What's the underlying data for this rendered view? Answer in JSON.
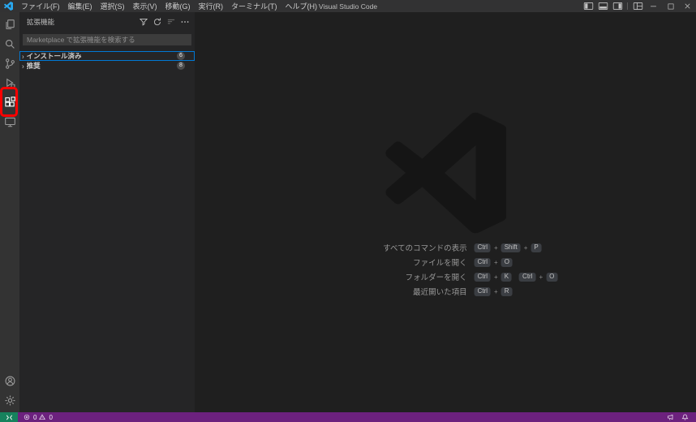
{
  "title_bar": {
    "app_title": "Visual Studio Code",
    "menus": [
      {
        "id": "file",
        "label": "ファイル(F)"
      },
      {
        "id": "edit",
        "label": "編集(E)"
      },
      {
        "id": "selection",
        "label": "選択(S)"
      },
      {
        "id": "view",
        "label": "表示(V)"
      },
      {
        "id": "go",
        "label": "移動(G)"
      },
      {
        "id": "run",
        "label": "実行(R)"
      },
      {
        "id": "terminal",
        "label": "ターミナル(T)"
      },
      {
        "id": "help",
        "label": "ヘルプ(H)"
      }
    ]
  },
  "sidebar": {
    "title": "拡張機能",
    "search_placeholder": "Marketplace で拡張機能を検索する",
    "sections": [
      {
        "id": "installed",
        "label": "インストール済み",
        "badge": "6",
        "focused": true
      },
      {
        "id": "recommended",
        "label": "推奨",
        "badge": "8",
        "focused": false
      }
    ]
  },
  "editor": {
    "key_separator": "+",
    "shortcuts": [
      {
        "label": "すべてのコマンドの表示",
        "groups": [
          [
            "Ctrl",
            "Shift",
            "P"
          ]
        ]
      },
      {
        "label": "ファイルを開く",
        "groups": [
          [
            "Ctrl",
            "O"
          ]
        ]
      },
      {
        "label": "フォルダーを開く",
        "groups": [
          [
            "Ctrl",
            "K"
          ],
          [
            "Ctrl",
            "O"
          ]
        ]
      },
      {
        "label": "最近開いた項目",
        "groups": [
          [
            "Ctrl",
            "R"
          ]
        ]
      }
    ]
  },
  "status_bar": {
    "errors": "0",
    "warnings": "0"
  },
  "annotation": {
    "target": "extensions-icon",
    "color": "#ff0000"
  },
  "colors": {
    "titlebar": "#323233",
    "activitybar": "#333333",
    "sidebar": "#252526",
    "editor": "#1f1f1f",
    "statusbar": "#6c217e",
    "remote": "#16825d",
    "focus": "#0078d4",
    "badge": "#4d4d4d",
    "annotation": "#ff0000"
  }
}
